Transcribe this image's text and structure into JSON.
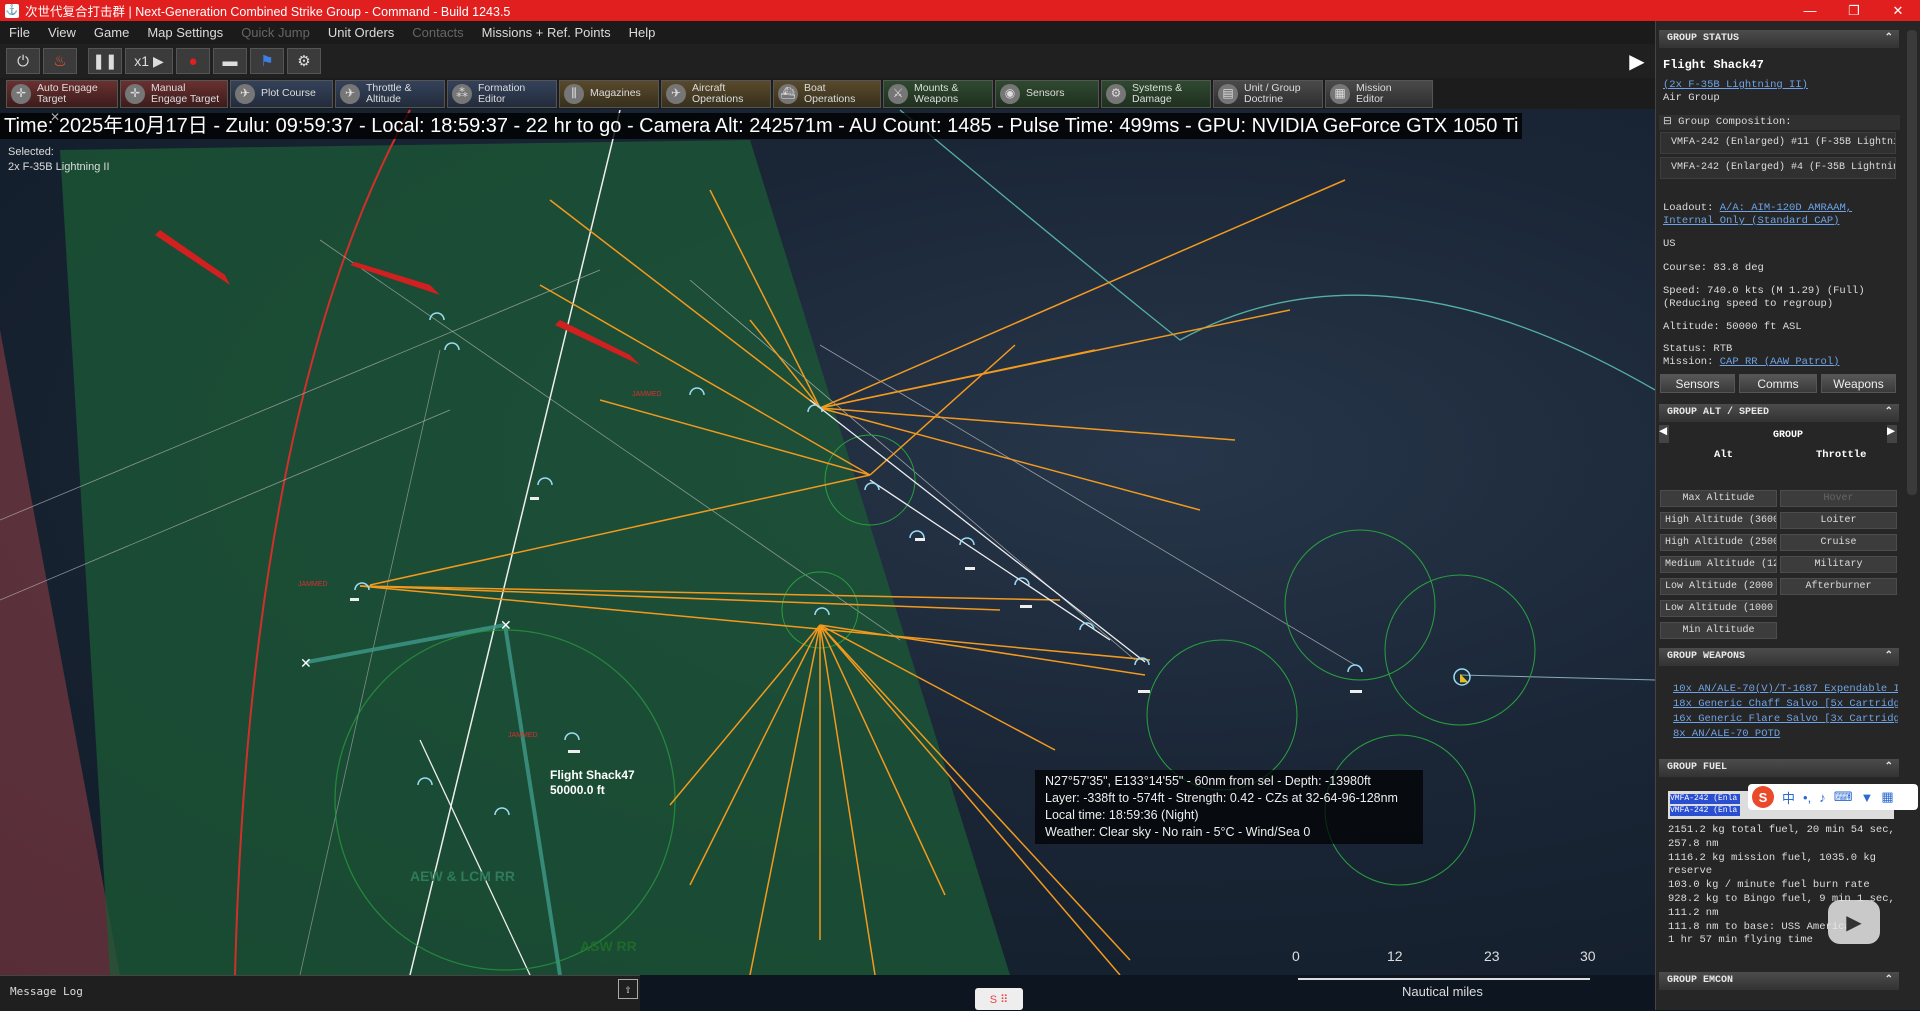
{
  "window": {
    "title": "次世代复合打击群 | Next-Generation Combined Strike Group - Command - Build 1243.5",
    "controls": [
      "—",
      "❐",
      "✕"
    ]
  },
  "menu": [
    "File",
    "View",
    "Game",
    "Map Settings",
    "Quick Jump",
    "Unit Orders",
    "Contacts",
    "Missions + Ref. Points",
    "Help"
  ],
  "toolbar": {
    "time_compression": "x1"
  },
  "commands": [
    {
      "label1": "Auto Engage",
      "label2": "Target",
      "icon": "crosshair-icon"
    },
    {
      "label1": "Manual",
      "label2": "Engage Target",
      "icon": "target-icon"
    },
    {
      "label1": "Plot Course",
      "label2": "",
      "icon": "course-icon"
    },
    {
      "label1": "Throttle &",
      "label2": "Altitude",
      "icon": "throttle-icon"
    },
    {
      "label1": "Formation",
      "label2": "Editor",
      "icon": "formation-icon"
    },
    {
      "label1": "Magazines",
      "label2": "",
      "icon": "magazine-icon"
    },
    {
      "label1": "Aircraft",
      "label2": "Operations",
      "icon": "aircraft-icon"
    },
    {
      "label1": "Boat",
      "label2": "Operations",
      "icon": "boat-icon"
    },
    {
      "label1": "Mounts &",
      "label2": "Weapons",
      "icon": "weapons-icon"
    },
    {
      "label1": "Sensors",
      "label2": "",
      "icon": "sensors-icon"
    },
    {
      "label1": "Systems &",
      "label2": "Damage",
      "icon": "systems-icon"
    },
    {
      "label1": "Unit / Group",
      "label2": "Doctrine",
      "icon": "doctrine-icon"
    },
    {
      "label1": "Mission",
      "label2": "Editor",
      "icon": "mission-icon"
    }
  ],
  "map": {
    "status_line": "Time: 2025年10月17日 - Zulu: 09:59:37 - Local: 18:59:37 - 22 hr to go  - Camera Alt: 242571m  - AU Count: 1485  - Pulse Time: 499ms  - GPU: NVIDIA GeForce GTX 1050 Ti",
    "selected_label": "Selected:",
    "selected_value": "2x F-35B Lightning II",
    "unit_name": "Flight Shack47",
    "unit_alt": "50000.0 ft",
    "rr_label1": "AEW & LCM RR",
    "rr_label2": "ASW RR",
    "jammed1": "JAMMED",
    "jammed2": "JAMMED",
    "jammed3": "JAMMED",
    "cursor_info": [
      "N27°57'35\", E133°14'55\" - 60nm from sel - Depth: -13980ft",
      "Layer: -338ft to -574ft - Strength: 0.42 - CZs at 32-64-96-128nm",
      "Local time: 18:59:36 (Night)",
      "Weather: Clear sky - No rain - 5°C - Wind/Sea 0"
    ],
    "scale_ticks": [
      "0",
      "12",
      "23",
      "30"
    ],
    "scale_unit": "Nautical miles"
  },
  "message_log": {
    "label": "Message Log"
  },
  "panel": {
    "group_status": "GROUP STATUS",
    "unit_title": "Flight Shack47",
    "unit_type": "(2x F-35B Lightning II)",
    "unit_class": "Air Group",
    "composition_label": "Group Composition:",
    "composition": [
      "VMFA-242 (Enlarged) #11 (F-35B Lightning II)",
      "VMFA-242 (Enlarged) #4 (F-35B Lightning II)"
    ],
    "loadout_label": "Loadout:",
    "loadout_value1": "A/A: AIM-120D AMRAAM,",
    "loadout_value2": "Internal Only (Standard CAP)",
    "side": "US",
    "course": "Course: 83.8 deg",
    "speed1": "Speed: 740.0 kts (M 1.29) (Full)",
    "speed2": "(Reducing speed to regroup)",
    "altitude": "Altitude: 50000 ft ASL",
    "status": "Status: RTB",
    "mission_label": "Mission:",
    "mission_value": "CAP RR (AAW Patrol)",
    "tab_sensors": "Sensors",
    "tab_comms": "Comms",
    "tab_weapons": "Weapons",
    "alt_speed_hdr": "GROUP ALT / SPEED",
    "group_label": "GROUP",
    "alt_col": "Alt",
    "throttle_col": "Throttle",
    "alt_options": [
      "Max Altitude",
      "High Altitude (36000",
      "High Altitude (25000",
      "Medium Altitude (12",
      "Low Altitude (2000",
      "Low Altitude (1000",
      "Min Altitude"
    ],
    "throttle_options": [
      "Hover",
      "Loiter",
      "Cruise",
      "Military",
      "Afterburner"
    ],
    "weapons_hdr": "GROUP WEAPONS",
    "weapons": [
      "10x AN/ALE-70(V)/T-1687 Expendable I",
      "18x Generic Chaff Salvo [5x Cartridg",
      "16x Generic Flare Salvo [3x Cartridg",
      "8x AN/ALE-70 POTD"
    ],
    "fuel_hdr": "GROUP FUEL",
    "fuel_bar1": "VMFA-242 (Enla",
    "fuel_bar2": "VMFA-242 (Enla",
    "fuel_lines": [
      "2151.2 kg total fuel, 20 min 54 sec,",
      "257.8 nm",
      "1116.2 kg mission fuel, 1035.0 kg",
      "reserve",
      "103.0 kg / minute fuel burn rate",
      "928.2 kg to Bingo fuel, 9 min 1 sec,",
      "111.2 nm",
      "111.8 nm to base: USS America",
      "1 hr 57 min flying time"
    ],
    "emcon_hdr": "GROUP EMCON"
  },
  "colors": {
    "titlebar": "#e21f1f",
    "orange_lines": "#f39a1e",
    "green_zone": "#1f6a35",
    "link": "#6fa3e6"
  }
}
